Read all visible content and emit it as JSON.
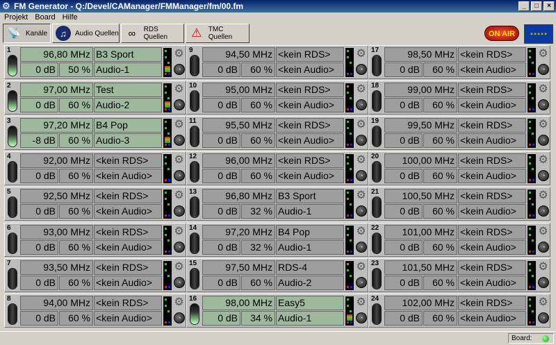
{
  "window": {
    "title": "FM Generator - Q:/Devel/CAManager/FMManager/fm/00.fm"
  },
  "menu": [
    {
      "label": "Projekt"
    },
    {
      "label": "Board"
    },
    {
      "label": "Hilfe"
    }
  ],
  "tabs": [
    {
      "label": "Kanäle",
      "icon": "antenna-icon",
      "active": true
    },
    {
      "label": "Audio Quellen",
      "icon": "music-note-icon",
      "active": false
    },
    {
      "label": "RDS Quellen",
      "icon": "rds-icon",
      "active": false
    },
    {
      "label": "TMC Quellen",
      "icon": "traffic-warning-icon",
      "active": false
    }
  ],
  "onair": {
    "label": "ON AIR"
  },
  "status": {
    "board_label": "Board:"
  },
  "colors": {
    "active_field": "#9db89d",
    "inactive_field": "#9e9e9e",
    "onair": "#d4200c"
  },
  "channels": [
    {
      "num": "1",
      "freq": "96,80 MHz",
      "level": "0 dB",
      "vol": "50 %",
      "rds": "B3 Sport",
      "audio": "Audio-1",
      "on": true
    },
    {
      "num": "2",
      "freq": "97,00 MHz",
      "level": "0 dB",
      "vol": "60 %",
      "rds": "Test",
      "audio": "Audio-2",
      "on": true
    },
    {
      "num": "3",
      "freq": "97,20 MHz",
      "level": "-8 dB",
      "vol": "60 %",
      "rds": "B4 Pop",
      "audio": "Audio-3",
      "on": true
    },
    {
      "num": "4",
      "freq": "92,00 MHz",
      "level": "0 dB",
      "vol": "60 %",
      "rds": "<kein RDS>",
      "audio": "<kein Audio>",
      "on": false
    },
    {
      "num": "5",
      "freq": "92,50 MHz",
      "level": "0 dB",
      "vol": "60 %",
      "rds": "<kein RDS>",
      "audio": "<kein Audio>",
      "on": false
    },
    {
      "num": "6",
      "freq": "93,00 MHz",
      "level": "0 dB",
      "vol": "60 %",
      "rds": "<kein RDS>",
      "audio": "<kein Audio>",
      "on": false
    },
    {
      "num": "7",
      "freq": "93,50 MHz",
      "level": "0 dB",
      "vol": "60 %",
      "rds": "<kein RDS>",
      "audio": "<kein Audio>",
      "on": false
    },
    {
      "num": "8",
      "freq": "94,00 MHz",
      "level": "0 dB",
      "vol": "60 %",
      "rds": "<kein RDS>",
      "audio": "<kein Audio>",
      "on": false
    },
    {
      "num": "9",
      "freq": "94,50 MHz",
      "level": "0 dB",
      "vol": "60 %",
      "rds": "<kein RDS>",
      "audio": "<kein Audio>",
      "on": false
    },
    {
      "num": "10",
      "freq": "95,00 MHz",
      "level": "0 dB",
      "vol": "60 %",
      "rds": "<kein RDS>",
      "audio": "<kein Audio>",
      "on": false
    },
    {
      "num": "11",
      "freq": "95,50 MHz",
      "level": "0 dB",
      "vol": "60 %",
      "rds": "<kein RDS>",
      "audio": "<kein Audio>",
      "on": false
    },
    {
      "num": "12",
      "freq": "96,00 MHz",
      "level": "0 dB",
      "vol": "60 %",
      "rds": "<kein RDS>",
      "audio": "<kein Audio>",
      "on": false
    },
    {
      "num": "13",
      "freq": "96,80 MHz",
      "level": "0 dB",
      "vol": "32 %",
      "rds": "B3 Sport",
      "audio": "Audio-1",
      "on": false
    },
    {
      "num": "14",
      "freq": "97,20 MHz",
      "level": "0 dB",
      "vol": "32 %",
      "rds": "B4 Pop",
      "audio": "Audio-1",
      "on": false
    },
    {
      "num": "15",
      "freq": "97,50 MHz",
      "level": "0 dB",
      "vol": "60 %",
      "rds": "RDS-4",
      "audio": "Audio-2",
      "on": false
    },
    {
      "num": "16",
      "freq": "98,00 MHz",
      "level": "0 dB",
      "vol": "34 %",
      "rds": "Easy5",
      "audio": "Audio-1",
      "on": true
    },
    {
      "num": "17",
      "freq": "98,50 MHz",
      "level": "0 dB",
      "vol": "60 %",
      "rds": "<kein RDS>",
      "audio": "<kein Audio>",
      "on": false
    },
    {
      "num": "18",
      "freq": "99,00 MHz",
      "level": "0 dB",
      "vol": "60 %",
      "rds": "<kein RDS>",
      "audio": "<kein Audio>",
      "on": false
    },
    {
      "num": "19",
      "freq": "99,50 MHz",
      "level": "0 dB",
      "vol": "60 %",
      "rds": "<kein RDS>",
      "audio": "<kein Audio>",
      "on": false
    },
    {
      "num": "20",
      "freq": "100,00 MHz",
      "level": "0 dB",
      "vol": "60 %",
      "rds": "<kein RDS>",
      "audio": "<kein Audio>",
      "on": false
    },
    {
      "num": "21",
      "freq": "100,50 MHz",
      "level": "0 dB",
      "vol": "60 %",
      "rds": "<kein RDS>",
      "audio": "<kein Audio>",
      "on": false
    },
    {
      "num": "22",
      "freq": "101,00 MHz",
      "level": "0 dB",
      "vol": "60 %",
      "rds": "<kein RDS>",
      "audio": "<kein Audio>",
      "on": false
    },
    {
      "num": "23",
      "freq": "101,50 MHz",
      "level": "0 dB",
      "vol": "60 %",
      "rds": "<kein RDS>",
      "audio": "<kein Audio>",
      "on": false
    },
    {
      "num": "24",
      "freq": "102,00 MHz",
      "level": "0 dB",
      "vol": "60 %",
      "rds": "<kein RDS>",
      "audio": "<kein Audio>",
      "on": false
    }
  ]
}
